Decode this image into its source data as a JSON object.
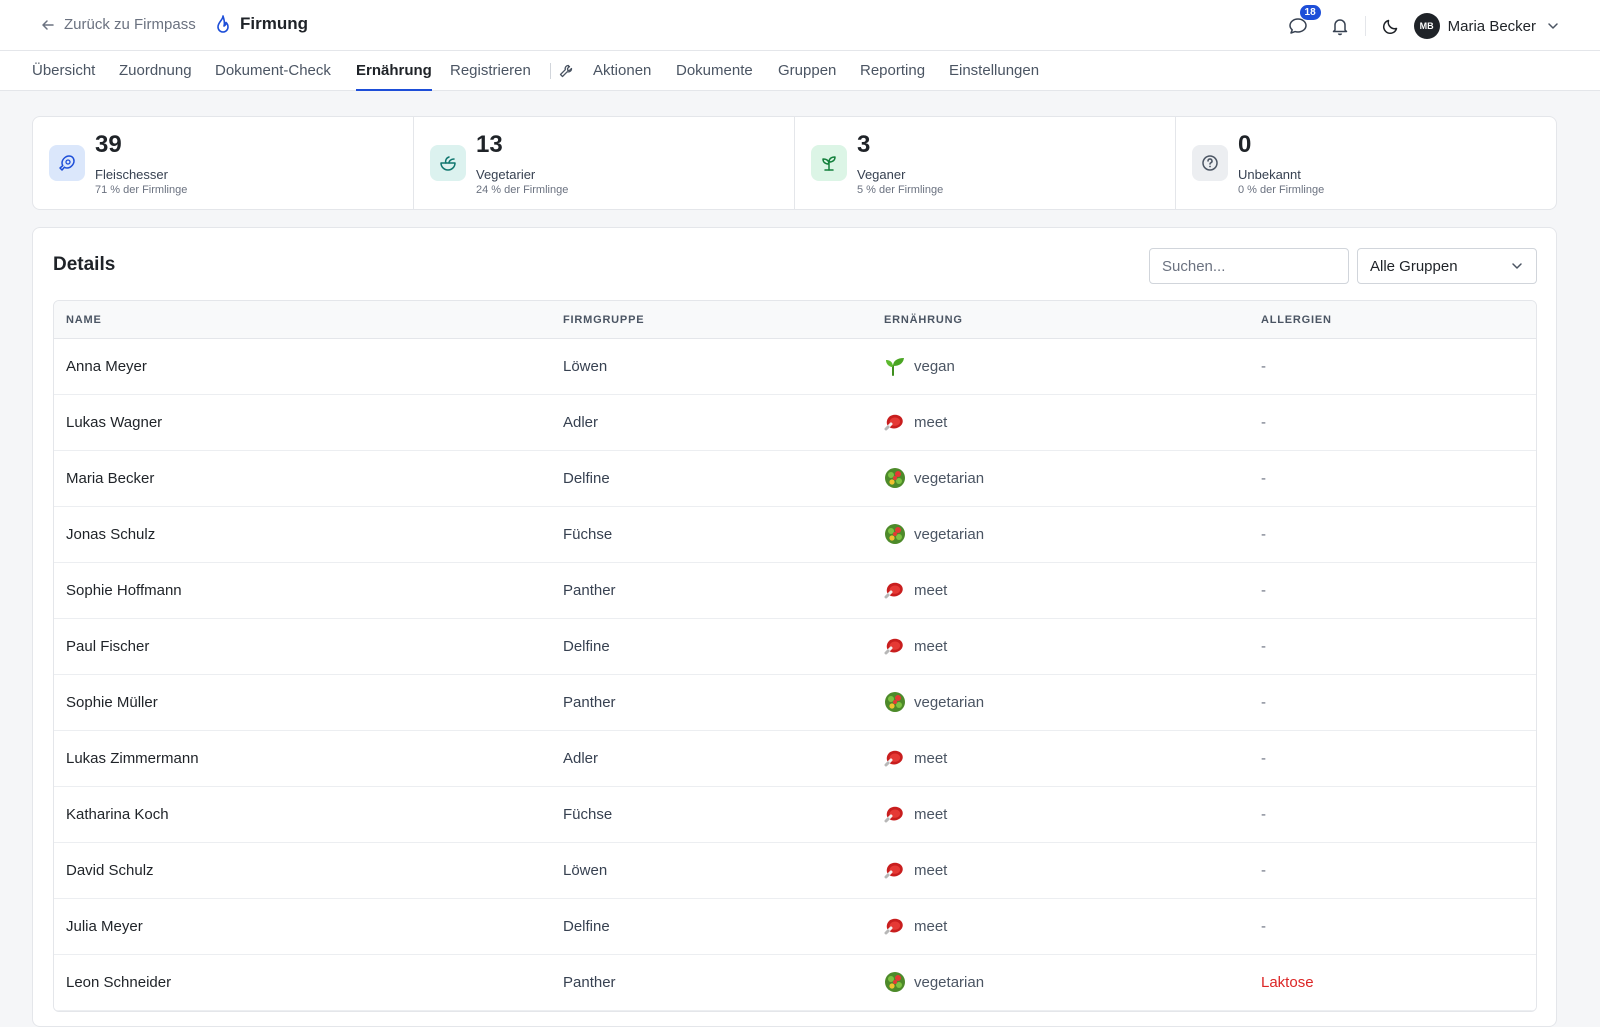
{
  "header": {
    "back_label": "Zurück zu Firmpass",
    "brand": "Firmung",
    "messages_count": "18",
    "user_initials": "MB",
    "user_name": "Maria Becker"
  },
  "nav": {
    "tabs": [
      {
        "label": "Übersicht",
        "active": false
      },
      {
        "label": "Zuordnung",
        "active": false
      },
      {
        "label": "Dokument-Check",
        "active": false
      },
      {
        "label": "Ernährung",
        "active": true
      },
      {
        "label": "Registrieren",
        "active": false
      },
      {
        "label": "Aktionen",
        "active": false
      },
      {
        "label": "Dokumente",
        "active": false
      },
      {
        "label": "Gruppen",
        "active": false
      },
      {
        "label": "Reporting",
        "active": false
      },
      {
        "label": "Einstellungen",
        "active": false
      }
    ]
  },
  "stats": [
    {
      "value": "39",
      "label": "Fleischesser",
      "sub": "71 % der Firmlinge",
      "icon": "meat-icon",
      "color": "#1d4ed8",
      "bg": "#dbe7fb"
    },
    {
      "value": "13",
      "label": "Vegetarier",
      "sub": "24 % der Firmlinge",
      "icon": "salad-icon",
      "color": "#0f766e",
      "bg": "#dcf2ef"
    },
    {
      "value": "3",
      "label": "Veganer",
      "sub": "5 % der Firmlinge",
      "icon": "sprout-icon",
      "color": "#15803d",
      "bg": "#dcf5e6"
    },
    {
      "value": "0",
      "label": "Unbekannt",
      "sub": "0 % der Firmlinge",
      "icon": "question-icon",
      "color": "#4b5563",
      "bg": "#eceef1"
    }
  ],
  "details": {
    "title": "Details",
    "search_placeholder": "Suchen...",
    "group_filter": "Alle Gruppen",
    "columns": [
      "NAME",
      "FIRMGRUPPE",
      "ERNÄHRUNG",
      "ALLERGIEN"
    ],
    "rows": [
      {
        "name": "Anna Meyer",
        "group": "Löwen",
        "diet": "vegan",
        "allergies": "-"
      },
      {
        "name": "Lukas Wagner",
        "group": "Adler",
        "diet": "meet",
        "allergies": "-"
      },
      {
        "name": "Maria Becker",
        "group": "Delfine",
        "diet": "vegetarian",
        "allergies": "-"
      },
      {
        "name": "Jonas Schulz",
        "group": "Füchse",
        "diet": "vegetarian",
        "allergies": "-"
      },
      {
        "name": "Sophie Hoffmann",
        "group": "Panther",
        "diet": "meet",
        "allergies": "-"
      },
      {
        "name": "Paul Fischer",
        "group": "Delfine",
        "diet": "meet",
        "allergies": "-"
      },
      {
        "name": "Sophie Müller",
        "group": "Panther",
        "diet": "vegetarian",
        "allergies": "-"
      },
      {
        "name": "Lukas Zimmermann",
        "group": "Adler",
        "diet": "meet",
        "allergies": "-"
      },
      {
        "name": "Katharina Koch",
        "group": "Füchse",
        "diet": "meet",
        "allergies": "-"
      },
      {
        "name": "David Schulz",
        "group": "Löwen",
        "diet": "meet",
        "allergies": "-"
      },
      {
        "name": "Julia Meyer",
        "group": "Delfine",
        "diet": "meet",
        "allergies": "-"
      },
      {
        "name": "Leon Schneider",
        "group": "Panther",
        "diet": "vegetarian",
        "allergies": "Laktose"
      }
    ]
  },
  "colors": {
    "accent": "#1d4ed8",
    "alert": "#dc2626"
  }
}
